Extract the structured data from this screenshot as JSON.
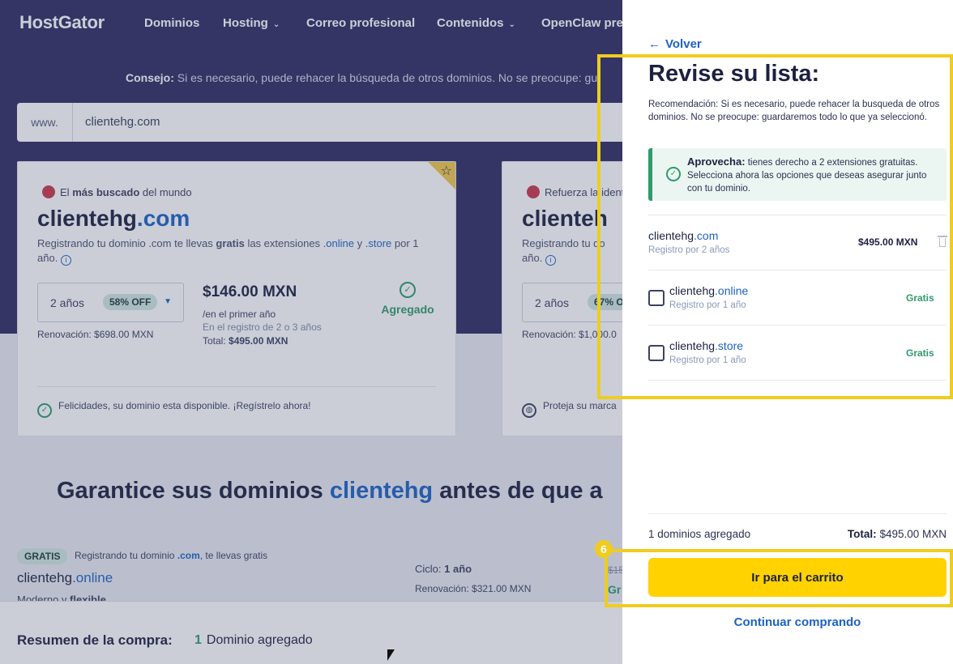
{
  "nav": {
    "logo": "HostGator",
    "items": [
      "Dominios",
      "Hosting",
      "Correo profesional",
      "Contenidos",
      "OpenClaw pre"
    ]
  },
  "hero": {
    "tip_label": "Consejo:",
    "tip_text": "Si es necesario, puede rehacer la búsqueda de otros dominios. No se preocupe: gu",
    "search_prefix": "www.",
    "search_value": "clientehg.com"
  },
  "card1": {
    "tag_pre": "El",
    "tag_bold": "más buscado",
    "tag_post": "del mundo",
    "name": "clientehg",
    "ext": ".com",
    "desc_pre": "Registrando tu dominio .com te llevas",
    "desc_bold": "gratis",
    "desc_mid": "las extensiones",
    "ext1": ".online",
    "desc_and": "y",
    "ext2": ".store",
    "desc_post": "por 1 año.",
    "years": "2 años",
    "discount": "58% OFF",
    "renewal": "Renovación: $698.00 MXN",
    "price": "$146.00 MXN",
    "price_sub": "/en el primer año",
    "price_sub2": "En el registro de 2 o 3 años",
    "total_label": "Total:",
    "total_value": "$495.00 MXN",
    "status": "Agregado",
    "available": "Felicidades, su dominio esta disponible. ¡Regístrelo ahora!"
  },
  "card2": {
    "tag": "Refuerza la identi",
    "name": "clienteh",
    "desc": "Registrando tu do",
    "desc2": "año.",
    "years": "2 años",
    "discount": "67% O",
    "renewal": "Renovación: $1,000.0",
    "footer": "Proteja su marca"
  },
  "guarantee": {
    "pre": "Garantice sus dominios",
    "highlight": "clientehg",
    "post": "antes de que a"
  },
  "upsell": {
    "pill": "GRATIS",
    "text_pre": "Registrando tu dominio",
    "text_ext": ".com",
    "text_post": ", te llevas gratis",
    "name": "clientehg",
    "ext": ".online",
    "sub_pre": "Moderno y",
    "sub_bold": "flexible",
    "cycle_label": "Ciclo:",
    "cycle_value": "1 año",
    "renewal": "Renovación: $321.00 MXN",
    "strike": "$15",
    "gratis_cut": "Gr"
  },
  "summary": {
    "label": "Resumen de la compra:",
    "count": "1",
    "count_text": "Dominio agregado"
  },
  "drawer": {
    "back": "Volver",
    "title": "Revise su lista:",
    "recommendation": "Recomendación: Si es necesario, puede rehacer la busqueda de otros dominios. No se preocupe: guardaremos todo lo que ya seleccionó.",
    "promo_bold": "Aprovecha:",
    "promo_text": "tienes derecho a 2 extensiones gratuitas. Selecciona ahora las opciones que deseas asegurar junto con tu dominio.",
    "items": [
      {
        "name": "clientehg",
        "ext": ".com",
        "sub": "Registro por 2 años",
        "price": "$495.00 MXN"
      },
      {
        "name": "clientehg",
        "ext": ".online",
        "sub": "Registro por 1 año",
        "price": "Gratis"
      },
      {
        "name": "clientehg",
        "ext": ".store",
        "sub": "Registro por 1 año",
        "price": "Gratis"
      }
    ],
    "added_count": "1 dominios agregado",
    "total_label": "Total:",
    "total_value": "$495.00 MXN",
    "cta": "Ir para el carrito",
    "continue": "Continuar comprando"
  },
  "annotation": {
    "step": "6",
    "color": "#f0cc1e"
  },
  "colors": {
    "navy": "#2f2c60",
    "link": "#1d62c4",
    "green": "#2f9a6a",
    "cta": "#ffd200"
  },
  "icons": [
    "back-arrow-icon",
    "check-circle-icon",
    "trash-icon",
    "star-icon",
    "info-icon",
    "chevron-down-icon",
    "badge-icon",
    "globe-icon"
  ]
}
